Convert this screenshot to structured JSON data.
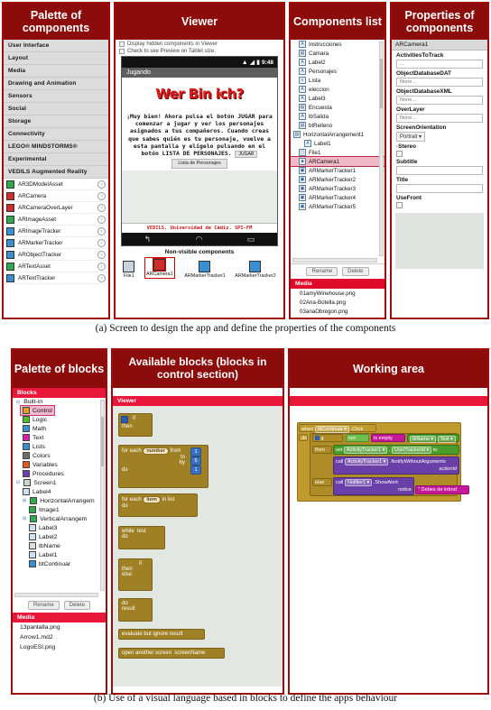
{
  "figures": {
    "a": {
      "caption": "(a) Screen to design the app and define the properties of the components"
    },
    "b": {
      "caption": "(b) Use of a visual language based in blocks to define the apps behaviour"
    }
  },
  "colors": {
    "panel_border": "#9d0b0b",
    "panel_title_bg": "#8c0b0b",
    "media_header": "#e8173a",
    "selection": "#f2b9c8"
  },
  "designer": {
    "palette": {
      "title": "Palette of components",
      "categories": [
        "User Interface",
        "Layout",
        "Media",
        "Drawing and Animation",
        "Sensors",
        "Social",
        "Storage",
        "Connectivity",
        "LEGO® MINDSTORMS®",
        "Experimental",
        "VEDILS Augmented Reality"
      ],
      "components": [
        {
          "label": "AR3DModelAsset",
          "color": "#2fa84f"
        },
        {
          "label": "ARCamera",
          "color": "#d12b2b"
        },
        {
          "label": "ARCameraOverLayer",
          "color": "#d12b2b"
        },
        {
          "label": "ARImageAsset",
          "color": "#2fa84f"
        },
        {
          "label": "ARImageTracker",
          "color": "#3a8fd0"
        },
        {
          "label": "ARMarkerTracker",
          "color": "#3a8fd0"
        },
        {
          "label": "ARObjectTracker",
          "color": "#3a8fd0"
        },
        {
          "label": "ARTextAsset",
          "color": "#2fa84f"
        },
        {
          "label": "ARTextTracker",
          "color": "#3a8fd0"
        }
      ],
      "help_icon": "?"
    },
    "viewer": {
      "title": "Viewer",
      "checkbox_hidden": "Display hidden components in Viewer",
      "checkbox_tablet": "Check to see Preview on Tablet size.",
      "phone": {
        "clock": "9:48",
        "status_icons": [
          "wifi-icon",
          "signal-icon",
          "battery-icon"
        ],
        "screen_title": "Jugando",
        "logo_text": "Wer Bin ich?",
        "body_text": "¡Muy bien! Ahora pulsa el botón JUGAR para comenzar a jugar y ver los personajes asignados a tus compañeros. Cuando creas que sabes quién es tu personaje, vuelve a esta pantalla y elígelo pulsando en el botón LISTA DE PERSONAJES.",
        "inline_button": "JUGAR",
        "list_button": "Lista de Personajes",
        "footer": "VEDILS. Universidad de Cádiz. SPI-FM",
        "nav_icons": [
          "back-icon",
          "home-icon",
          "recents-icon"
        ]
      },
      "nonvisible": {
        "title": "Non-visible components",
        "items": [
          {
            "label": "File1",
            "color": "#c9d3dd",
            "selected": false
          },
          {
            "label": "ARCamera1",
            "color": "#d12b2b",
            "selected": true
          },
          {
            "label": "ARMarkerTracker1",
            "color": "#3a8fd0",
            "selected": false
          },
          {
            "label": "ARMarkerTracker2",
            "color": "#3a8fd0",
            "selected": false
          }
        ]
      }
    },
    "components_list": {
      "title": "Components list",
      "tree": [
        {
          "label": "Instrucciones",
          "indent": 1,
          "icon": "A",
          "selected": false
        },
        {
          "label": "Camara",
          "indent": 1,
          "icon": "▤",
          "selected": false
        },
        {
          "label": "Label2",
          "indent": 1,
          "icon": "A",
          "selected": false
        },
        {
          "label": "Personajes",
          "indent": 1,
          "icon": "A",
          "selected": false
        },
        {
          "label": "Lista",
          "indent": 1,
          "icon": "≡",
          "selected": false
        },
        {
          "label": "eleccion",
          "indent": 1,
          "icon": "A",
          "selected": false
        },
        {
          "label": "Label3",
          "indent": 1,
          "icon": "A",
          "selected": false
        },
        {
          "label": "Encuesta",
          "indent": 1,
          "icon": "▤",
          "selected": false
        },
        {
          "label": "lbSalida",
          "indent": 1,
          "icon": "A",
          "selected": false
        },
        {
          "label": "btRelleno",
          "indent": 1,
          "icon": "▤",
          "selected": false
        },
        {
          "label": "HorizontalArrangement1",
          "indent": 0,
          "icon": "▥",
          "selected": false
        },
        {
          "label": "Label1",
          "indent": 2,
          "icon": "A",
          "selected": false
        },
        {
          "label": "File1",
          "indent": 1,
          "icon": "▢",
          "selected": false
        },
        {
          "label": "ARCamera1",
          "indent": 1,
          "icon": "■",
          "selected": true
        },
        {
          "label": "ARMarkerTracker1",
          "indent": 1,
          "icon": "▣",
          "selected": false
        },
        {
          "label": "ARMarkerTracker2",
          "indent": 1,
          "icon": "▣",
          "selected": false
        },
        {
          "label": "ARMarkerTracker3",
          "indent": 1,
          "icon": "▣",
          "selected": false
        },
        {
          "label": "ARMarkerTracker4",
          "indent": 1,
          "icon": "▣",
          "selected": false
        },
        {
          "label": "ARMarkerTracker5",
          "indent": 1,
          "icon": "▣",
          "selected": false
        }
      ],
      "rename_button": "Rename",
      "delete_button": "Delete",
      "media_header": "Media",
      "media_items": [
        "01amyWinehouse.png",
        "02Ana-Botella.png",
        "03anaObregon.png"
      ]
    },
    "properties": {
      "title": "Properties of components",
      "selected_component": "ARCamera1",
      "fields": [
        {
          "name": "ActivitiesToTrack",
          "type": "text",
          "value": "..."
        },
        {
          "name": "ObjectDatabaseDAT",
          "type": "text",
          "value": "None..."
        },
        {
          "name": "ObjectDatabaseXML",
          "type": "text",
          "value": "None..."
        },
        {
          "name": "OverLayer",
          "type": "text",
          "value": "None..."
        },
        {
          "name": "ScreenOrientation",
          "type": "dropdown",
          "value": "Portrait"
        },
        {
          "name": "·Stereo",
          "type": "checkbox",
          "value": ""
        },
        {
          "name": "Subtitle",
          "type": "text",
          "value": ""
        },
        {
          "name": "Title",
          "type": "text",
          "value": ""
        },
        {
          "name": "UseFront",
          "type": "checkbox",
          "value": ""
        }
      ]
    }
  },
  "blocks_editor": {
    "palette": {
      "title": "Palette of blocks",
      "header": "Blocks",
      "tree": [
        {
          "label": "Built-in",
          "indent": 0,
          "color": "",
          "expander": "⊟"
        },
        {
          "label": "Control",
          "indent": 1,
          "color": "#d8a321",
          "selected": true
        },
        {
          "label": "Logic",
          "indent": 1,
          "color": "#4ec12a"
        },
        {
          "label": "Math",
          "indent": 1,
          "color": "#3a8fd0"
        },
        {
          "label": "Text",
          "indent": 1,
          "color": "#d41fa8"
        },
        {
          "label": "Lists",
          "indent": 1,
          "color": "#3a8fd0"
        },
        {
          "label": "Colors",
          "indent": 1,
          "color": "#6e6e6e"
        },
        {
          "label": "Variables",
          "indent": 1,
          "color": "#e05a1f"
        },
        {
          "label": "Procedures",
          "indent": 1,
          "color": "#6a3fa8"
        },
        {
          "label": "Screen1",
          "indent": 0,
          "color": "#c8d8c8",
          "expander": "⊟"
        },
        {
          "label": "Label4",
          "indent": 1,
          "color": "#cfe0f0"
        },
        {
          "label": "HorizontalArrangem",
          "indent": 1,
          "color": "#2fa84f",
          "expander": "⊞"
        },
        {
          "label": "Image1",
          "indent": 2,
          "color": "#2fa84f"
        },
        {
          "label": "VerticalArrangem",
          "indent": 1,
          "color": "#2fa84f",
          "expander": "⊞"
        },
        {
          "label": "Label3",
          "indent": 2,
          "color": "#cfe0f0"
        },
        {
          "label": "Label2",
          "indent": 2,
          "color": "#cfe0f0"
        },
        {
          "label": "tbName",
          "indent": 2,
          "color": "#dcdcdc"
        },
        {
          "label": "Label1",
          "indent": 2,
          "color": "#cfe0f0"
        },
        {
          "label": "btContinuar",
          "indent": 2,
          "color": "#3a8fd0"
        }
      ],
      "rename_button": "Rename",
      "delete_button": "Delete",
      "media_header": "Media",
      "media_items": [
        "13pantalla.png",
        "Arrow1.md2",
        "LogoESI.png"
      ]
    },
    "available": {
      "title": "Available blocks (blocks in control section)",
      "viewer_label": "Viewer",
      "blocks": [
        {
          "id": "if-then",
          "lines": [
            "if",
            "then"
          ]
        },
        {
          "id": "for-each-number",
          "lines": [
            "for each",
            "number",
            "from",
            "to",
            "by",
            "do"
          ],
          "values": [
            "1",
            "5",
            "1"
          ]
        },
        {
          "id": "for-each-item",
          "lines": [
            "for each",
            "item",
            "in list",
            "do"
          ]
        },
        {
          "id": "while-test",
          "lines": [
            "while",
            "test",
            "do"
          ]
        },
        {
          "id": "if-then-else",
          "lines": [
            "if",
            "then",
            "else"
          ]
        },
        {
          "id": "do-result",
          "lines": [
            "do",
            "result"
          ]
        },
        {
          "id": "evaluate",
          "lines": [
            "evaluate but ignore result"
          ]
        },
        {
          "id": "open-screen",
          "lines": [
            "open another screen",
            "screenName"
          ]
        }
      ]
    },
    "working_area": {
      "title": "Working area",
      "program": {
        "when": "when",
        "when_target": "btContinuar",
        "when_event": ".Click",
        "do": "do",
        "if": "if",
        "not": "not",
        "is_empty": "is empty",
        "tbname": "tbName",
        "tbname_prop": "Text",
        "then": "then",
        "set": "set",
        "set_target": "ActivityTracker1",
        "set_prop": "UserTrackerId",
        "to": "to",
        "call1": "call",
        "call1_target": "ActivityTracker1",
        "call1_method": ".NotifyWithoutArguments",
        "call1_arg": "actionId",
        "else": "else",
        "call2": "call",
        "call2_target": "Notifier1",
        "call2_method": ".ShowAlert",
        "call2_arg": "notice",
        "call2_value": "Debes de introd"
      }
    }
  }
}
